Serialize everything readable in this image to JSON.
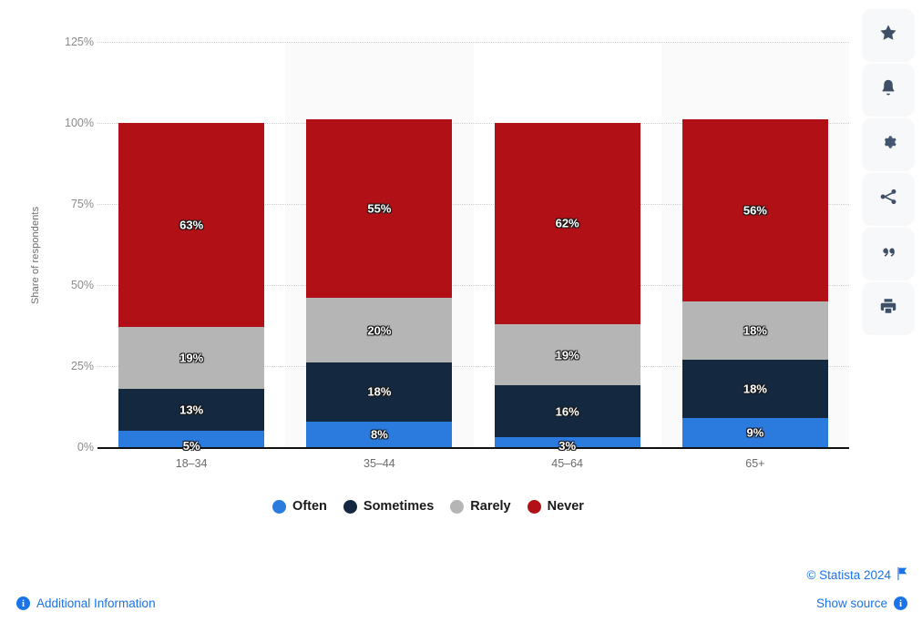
{
  "chart_data": {
    "type": "bar",
    "subtype": "stacked-bar",
    "title": "",
    "xlabel": "",
    "ylabel": "Share of respondents",
    "categories": [
      "18–34",
      "35–44",
      "45–64",
      "65+"
    ],
    "series": [
      {
        "name": "Often",
        "color": "#2b7bdf",
        "values": [
          5,
          8,
          3,
          9
        ]
      },
      {
        "name": "Sometimes",
        "color": "#14293f",
        "values": [
          13,
          18,
          16,
          18
        ]
      },
      {
        "name": "Rarely",
        "color": "#b5b5b5",
        "values": [
          19,
          20,
          19,
          18
        ]
      },
      {
        "name": "Never",
        "color": "#b11116",
        "values": [
          63,
          55,
          62,
          56
        ]
      }
    ],
    "value_labels": [
      [
        "5%",
        "13%",
        "19%",
        "63%"
      ],
      [
        "8%",
        "18%",
        "20%",
        "55%"
      ],
      [
        "3%",
        "16%",
        "19%",
        "62%"
      ],
      [
        "9%",
        "18%",
        "18%",
        "56%"
      ]
    ],
    "ylim": [
      0,
      125
    ],
    "yticks": [
      0,
      25,
      50,
      75,
      100,
      125
    ],
    "ytick_labels": [
      "0%",
      "25%",
      "50%",
      "75%",
      "100%",
      "125%"
    ],
    "grid": true,
    "legend_position": "bottom"
  },
  "legend": {
    "items": [
      {
        "label": "Often",
        "color": "#2b7bdf"
      },
      {
        "label": "Sometimes",
        "color": "#14293f"
      },
      {
        "label": "Rarely",
        "color": "#b5b5b5"
      },
      {
        "label": "Never",
        "color": "#b11116"
      }
    ]
  },
  "toolbar": {
    "buttons": [
      {
        "icon": "star-icon",
        "label": "Favorite"
      },
      {
        "icon": "bell-icon",
        "label": "Notifications"
      },
      {
        "icon": "gear-icon",
        "label": "Settings"
      },
      {
        "icon": "share-icon",
        "label": "Share"
      },
      {
        "icon": "quote-icon",
        "label": "Cite"
      },
      {
        "icon": "print-icon",
        "label": "Print"
      }
    ]
  },
  "footer": {
    "copyright": "© Statista 2024",
    "flag_icon": "flag-icon",
    "additional_information": "Additional Information",
    "show_source": "Show source",
    "info_icon": "info-icon",
    "link_color": "#1a73e8"
  }
}
